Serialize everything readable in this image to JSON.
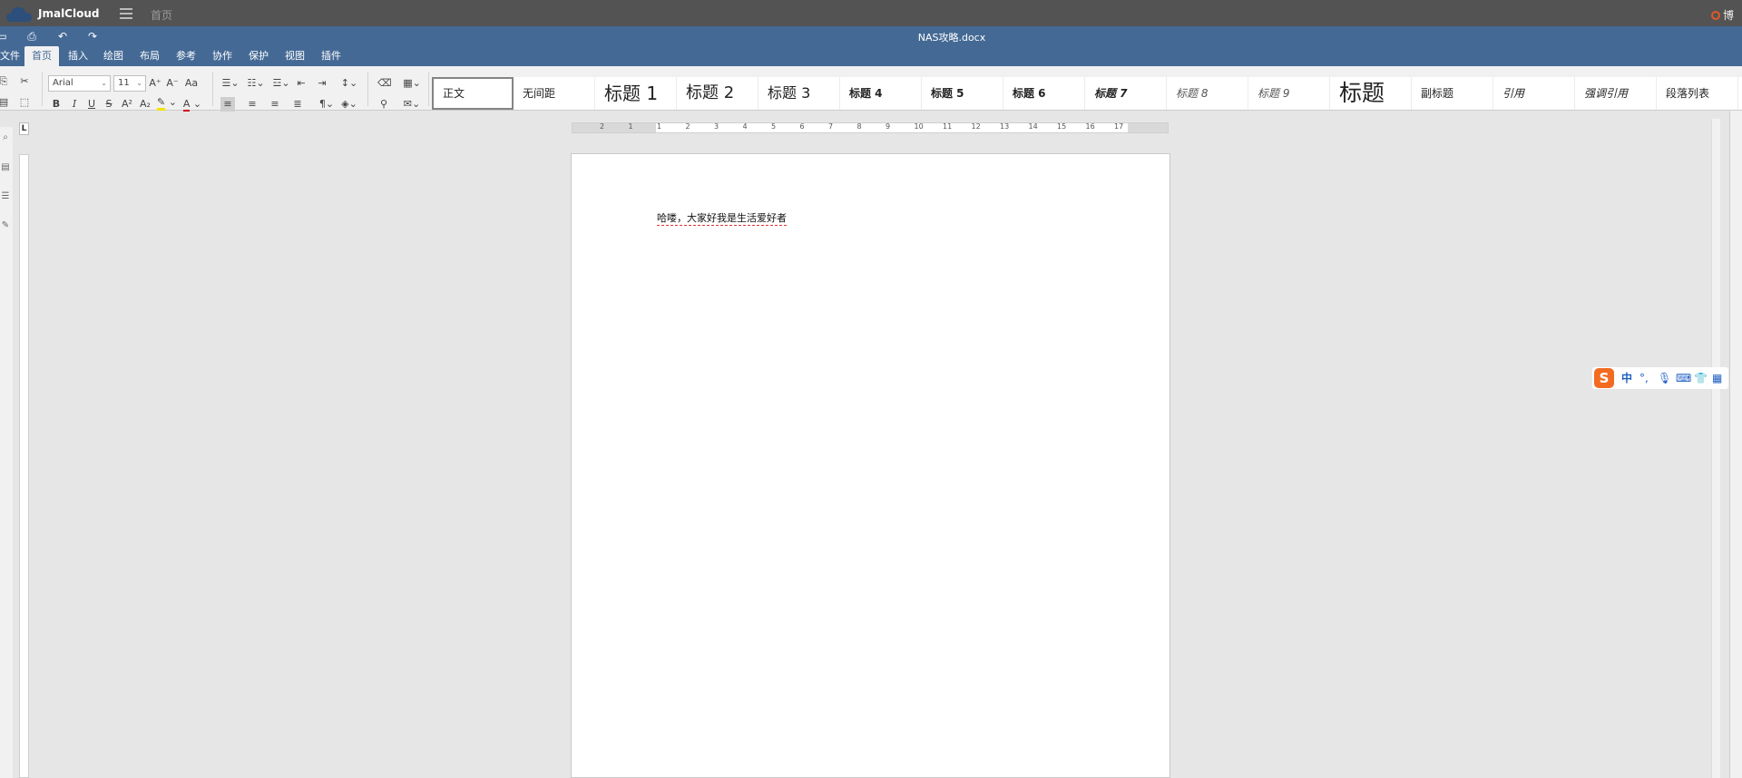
{
  "topbar": {
    "brand": "JmalCloud",
    "nav_home": "首页",
    "right_link": "博"
  },
  "titlebar": {
    "document_title": "NAS攻略.docx"
  },
  "tabs": [
    {
      "label": "文件"
    },
    {
      "label": "首页"
    },
    {
      "label": "插入"
    },
    {
      "label": "绘图"
    },
    {
      "label": "布局"
    },
    {
      "label": "参考"
    },
    {
      "label": "协作"
    },
    {
      "label": "保护"
    },
    {
      "label": "视图"
    },
    {
      "label": "插件"
    }
  ],
  "toolbar": {
    "font_name": "Arial",
    "font_size": "11",
    "bold": "B",
    "italic": "I",
    "underline": "U",
    "strike": "S",
    "superscript": "A²",
    "subscript": "A₂",
    "font_color": "A",
    "grow_font": "A⁺",
    "shrink_font": "A⁻",
    "change_case": "Aa"
  },
  "styles": [
    {
      "label": "正文"
    },
    {
      "label": "无间距"
    },
    {
      "label": "标题 1"
    },
    {
      "label": "标题 2"
    },
    {
      "label": "标题 3"
    },
    {
      "label": "标题 4"
    },
    {
      "label": "标题 5"
    },
    {
      "label": "标题 6"
    },
    {
      "label": "标题 7"
    },
    {
      "label": "标题 8"
    },
    {
      "label": "标题 9"
    },
    {
      "label": "标题"
    },
    {
      "label": "副标题"
    },
    {
      "label": "引用"
    },
    {
      "label": "强调引用"
    },
    {
      "label": "段落列表"
    }
  ],
  "ruler": {
    "corner": "L",
    "numbers": [
      "2",
      "1",
      "1",
      "2",
      "3",
      "4",
      "5",
      "6",
      "7",
      "8",
      "9",
      "10",
      "11",
      "12",
      "13",
      "14",
      "15",
      "16",
      "17"
    ]
  },
  "document": {
    "text": "哈喽，大家好我是生活爱好者"
  },
  "ime": {
    "logo": "S",
    "mode": "中"
  },
  "colors": {
    "topbar": "#535353",
    "ribbon": "#446995",
    "toolbar": "#f1f1f1",
    "ime_orange": "#f26b21",
    "ime_blue": "#1e5fc3"
  }
}
